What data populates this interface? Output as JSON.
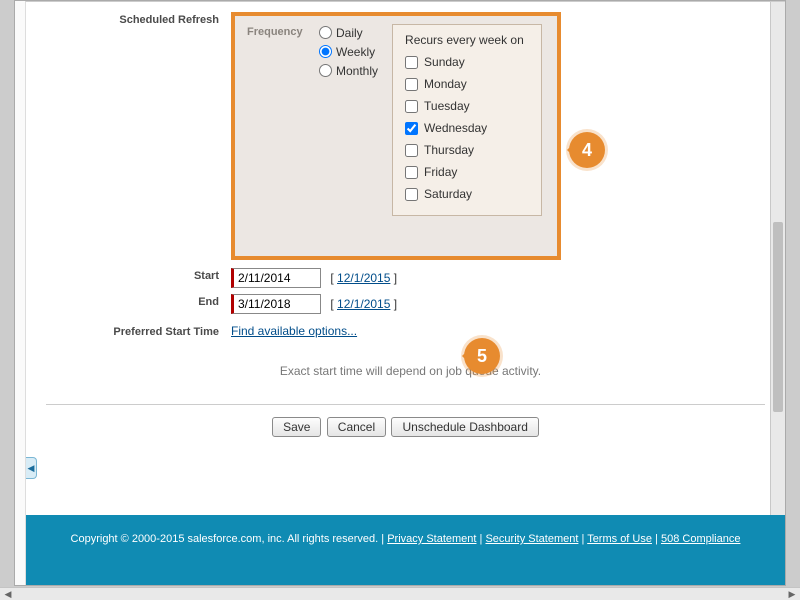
{
  "section_title": "Scheduled Refresh",
  "frequency": {
    "label": "Frequency",
    "options": {
      "daily": "Daily",
      "weekly": "Weekly",
      "monthly": "Monthly"
    },
    "selected": "weekly",
    "recurs_title": "Recurs every week on",
    "days": {
      "sunday": "Sunday",
      "monday": "Monday",
      "tuesday": "Tuesday",
      "wednesday": "Wednesday",
      "thursday": "Thursday",
      "friday": "Friday",
      "saturday": "Saturday"
    },
    "days_checked": [
      "wednesday"
    ]
  },
  "start": {
    "label": "Start",
    "value": "2/11/2014",
    "hint": "12/1/2015"
  },
  "end": {
    "label": "End",
    "value": "3/11/2018",
    "hint": "12/1/2015"
  },
  "preferred": {
    "label": "Preferred Start Time",
    "link": "Find available options..."
  },
  "note": "Exact start time will depend on job queue activity.",
  "buttons": {
    "save": "Save",
    "cancel": "Cancel",
    "unschedule": "Unschedule Dashboard"
  },
  "callouts": {
    "c4": "4",
    "c5": "5"
  },
  "footer": {
    "copyright": "Copyright © 2000-2015 salesforce.com, inc. All rights reserved.",
    "sep": " | ",
    "links": {
      "privacy": "Privacy Statement",
      "security": "Security Statement",
      "terms": "Terms of Use",
      "s508": "508 Compliance"
    }
  }
}
